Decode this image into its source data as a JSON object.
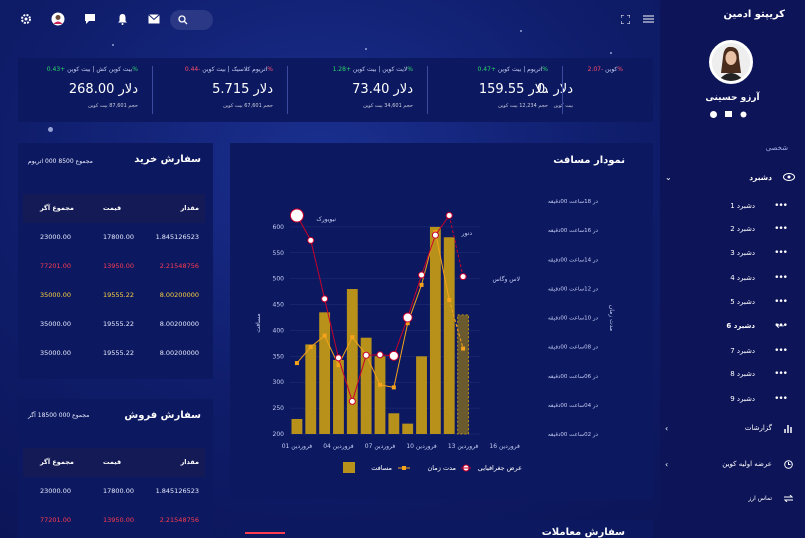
{
  "app": {
    "brand": "کریپتو ادمین",
    "user": "آرزو حسینی"
  },
  "nav": {
    "section": "شخصی",
    "items": [
      {
        "label": "دشبرد",
        "active": true
      },
      {
        "label": "دشبرد 1"
      },
      {
        "label": "دشبرد 2"
      },
      {
        "label": "دشبرد 3"
      },
      {
        "label": "دشبرد 4"
      },
      {
        "label": "دشبرد 5"
      },
      {
        "label": "دشبرد 6",
        "current": true
      },
      {
        "label": "دشبرد 7"
      },
      {
        "label": "دشبرد 8"
      },
      {
        "label": "دشبرد 9"
      },
      {
        "label": "گزارشات"
      },
      {
        "label": "عرضه اولیه کوین"
      },
      {
        "label": "تماس ارز"
      }
    ]
  },
  "ticker": [
    {
      "name": "کوین",
      "change": "-2.07%",
      "neg": true,
      "value": "0. دلار",
      "sub": "بیت کوین"
    },
    {
      "name": "اتریوم | بیت کوین",
      "change": "+0.47%",
      "neg": false,
      "value": "159.55 دلار",
      "sub": "حجم 12,234 بیت کوین"
    },
    {
      "name": "لایت کوین | بیت کوین",
      "change": "+1.28%",
      "neg": false,
      "value": "73.40 دلار",
      "sub": "حجم 34,601 بیت کوین"
    },
    {
      "name": "اتریوم کلاسیک | بیت کوین",
      "change": "-0.44%",
      "neg": true,
      "value": "5.715 دلار",
      "sub": "حجم 67,601 بیت کوین"
    },
    {
      "name": "بیت کوین کش | بیت کوین",
      "change": "+0.43%",
      "neg": false,
      "value": "268.00 دلار",
      "sub": "حجم 87,601 بیت کوین"
    }
  ],
  "buy": {
    "title": "سفارش خرید",
    "sub": "مجموع 8500 000 اتریوم",
    "cols": [
      "مقدار",
      "قیمت",
      "مجموع آگر"
    ],
    "rows": [
      [
        "1.845126523",
        "17800.00",
        "23000.00",
        "w"
      ],
      [
        "2.21548756",
        "13950.00",
        "77201.00",
        "r"
      ],
      [
        "8.00200000",
        "19555.22",
        "35000.00",
        "y"
      ],
      [
        "8.00200000",
        "19555.22",
        "35000.00",
        "w"
      ],
      [
        "8.00200000",
        "19555.22",
        "35000.00",
        "w"
      ]
    ]
  },
  "sell": {
    "title": "سفارش فروش",
    "sub": "مجموع 000 18500 آگر",
    "cols": [
      "مقدار",
      "قیمت",
      "مجموع آگر"
    ],
    "rows": [
      [
        "1.845126523",
        "17800.00",
        "23000.00",
        "w"
      ],
      [
        "2.21548756",
        "13950.00",
        "77201.00",
        "r"
      ]
    ]
  },
  "chart_data": {
    "type": "bar",
    "title": "نمودار مسافت",
    "ylabel": "مسافت",
    "y2label": "مدت زمان",
    "ylim": [
      200,
      650
    ],
    "yticks": [
      200,
      250,
      300,
      350,
      400,
      450,
      500,
      550,
      600
    ],
    "y2ticks": [
      "در 02ساعت 00دقیقه",
      "در 04ساعت 00دقیقه",
      "در 06ساعت 00دقیقه",
      "در 08ساعت 00دقیقه",
      "در 10ساعت 00دقیقه",
      "در 12ساعت 00دقیقه",
      "در 14ساعت 00دقیقه",
      "در 16ساعت 00دقیقه",
      "در 18ساعت 00دقیقه"
    ],
    "xticks": [
      "فروردین 01",
      "فروردین 04",
      "فروردین 07",
      "فروردین 10",
      "فروردین 13",
      "فروردین 16"
    ],
    "series": [
      {
        "name": "مسافت",
        "type": "bar",
        "values": [
          229,
          373,
          435,
          343,
          480,
          386,
          350,
          240,
          220,
          350,
          600,
          580,
          430
        ]
      },
      {
        "name": "مدت زمان",
        "type": "line",
        "values": [
          337,
          368,
          390,
          333,
          387,
          353,
          295,
          290,
          414,
          488,
          590,
          459,
          365
        ]
      },
      {
        "name": "عرض جغرافیایی",
        "type": "line",
        "values": [
          622,
          574,
          461,
          347,
          263,
          352,
          353,
          351,
          425,
          507,
          584,
          622,
          504
        ]
      }
    ],
    "annotations": [
      "نیویورک",
      "دنور",
      "لاس وگاس"
    ]
  },
  "footer": {
    "title": "سفارش معاملات"
  }
}
